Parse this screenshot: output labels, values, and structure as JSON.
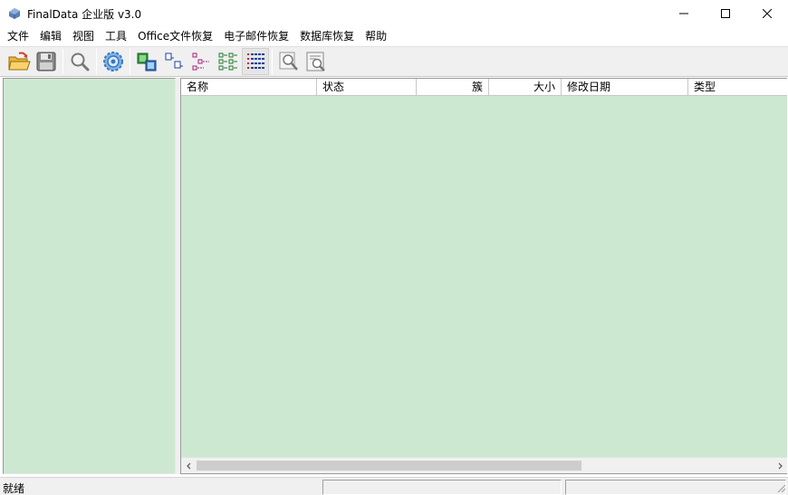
{
  "window": {
    "title": "FinalData 企业版 v3.0",
    "app_icon": "finaldata-app-icon",
    "controls": [
      "minimize-icon",
      "maximize-icon",
      "close-icon"
    ]
  },
  "menu": {
    "items": [
      "文件",
      "编辑",
      "视图",
      "工具",
      "Office文件恢复",
      "电子邮件恢复",
      "数据库恢复",
      "帮助"
    ]
  },
  "toolbar": {
    "buttons": [
      {
        "icon": "open-folder-icon"
      },
      {
        "icon": "save-disk-icon"
      },
      {
        "icon": "search-magnifier-icon"
      },
      {
        "icon": "settings-gear-icon"
      },
      {
        "icon": "large-icons-view-icon"
      },
      {
        "icon": "small-icons-view-icon"
      },
      {
        "icon": "tree-view-icon"
      },
      {
        "icon": "list-view-icon"
      },
      {
        "icon": "details-view-icon",
        "pressed": true
      },
      {
        "icon": "find-icon"
      },
      {
        "icon": "preview-icon"
      }
    ]
  },
  "list": {
    "columns": [
      {
        "label": "名称",
        "align": "left"
      },
      {
        "label": "状态",
        "align": "left"
      },
      {
        "label": "簇",
        "align": "right"
      },
      {
        "label": "大小",
        "align": "right"
      },
      {
        "label": "修改日期",
        "align": "left"
      },
      {
        "label": "类型",
        "align": "left"
      }
    ],
    "rows": []
  },
  "status": {
    "text": "就绪"
  },
  "colors": {
    "pane_background": "#cde8d1",
    "chrome": "#f0f0f0"
  }
}
